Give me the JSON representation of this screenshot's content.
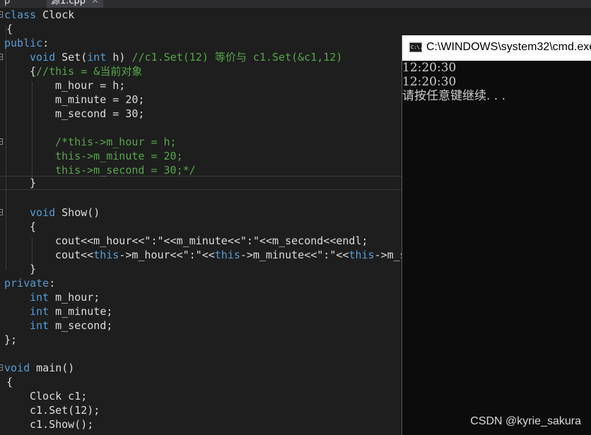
{
  "tabs": [
    {
      "label": "p",
      "active": false
    },
    {
      "label": "源1.cpp",
      "active": true,
      "close_glyph": "✕"
    }
  ],
  "code": {
    "l1": [
      "class",
      " Clock"
    ],
    "l2": " {",
    "l3": [
      "public",
      ":"
    ],
    "l4": [
      "void",
      " Set(",
      "int",
      " h) ",
      "//c1.Set(12) 等价与 c1.Set(&c1,12)"
    ],
    "l5": [
      "{",
      "//this = &当前对象"
    ],
    "l6": "m_hour = h;",
    "l7": "m_minute = 20;",
    "l8": "m_second = 30;",
    "l10": "/*this->m_hour = h;",
    "l11": "this->m_minute = 20;",
    "l12": "this->m_second = 30;*/",
    "l13": "}",
    "l15": [
      "void",
      " Show()"
    ],
    "l16": "{",
    "l17": "cout<<m_hour<<\":\"<<m_minute<<\":\"<<m_second<<endl;",
    "l18": [
      "cout<<",
      "this",
      "->m_hour<<\":\"<<",
      "this",
      "->m_minute<<\":\"<<",
      "this",
      "->m_s"
    ],
    "l19": "}",
    "l20": [
      "private",
      ":"
    ],
    "l21": [
      "int",
      " m_hour;"
    ],
    "l22": [
      "int",
      " m_minute;"
    ],
    "l23": [
      "int",
      " m_second;"
    ],
    "l24": "};",
    "l26": [
      "void",
      " main()"
    ],
    "l27": " {",
    "l28": "Clock c1;",
    "l29": "c1.Set(12);",
    "l30": "c1.Show();"
  },
  "console": {
    "title": "C:\\WINDOWS\\system32\\cmd.exe",
    "icon_label": "C:\\.",
    "icon": "cmd-icon",
    "lines": [
      "12:20:30",
      "12:20:30",
      "请按任意键继续. . ."
    ]
  },
  "watermark": "CSDN @kyrie_sakura",
  "colors": {
    "keyword": "#569cd6",
    "comment": "#57a64a",
    "text": "#dcdcdc",
    "editor_bg": "#1e1e1e",
    "console_bg": "#0c0c0c"
  }
}
